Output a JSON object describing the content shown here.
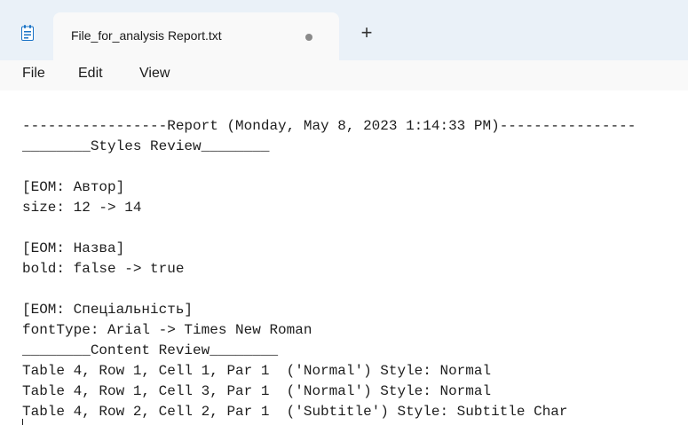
{
  "tab": {
    "title": "File_for_analysis Report.txt",
    "new_tab_label": "+"
  },
  "menu": {
    "file": "File",
    "edit": "Edit",
    "view": "View"
  },
  "icons": {
    "app": "notepad-icon",
    "unsaved": "unsaved-dot-icon",
    "new_tab": "plus-icon"
  },
  "colors": {
    "tabbar_bg": "#eaf1f8",
    "tab_bg": "#f9f9f9",
    "icon_accent": "#1a73c6"
  },
  "content": {
    "lines": [
      "-----------------Report (Monday, May 8, 2023 1:14:33 PM)----------------",
      "________Styles Review________",
      "",
      "[EOM: Автор]",
      "size: 12 -> 14",
      "",
      "[EOM: Назва]",
      "bold: false -> true",
      "",
      "[EOM: Спеціальність]",
      "fontType: Arial -> Times New Roman",
      "________Content Review________",
      "Table 4, Row 1, Cell 1, Par 1  ('Normal') Style: Normal",
      "Table 4, Row 1, Cell 3, Par 1  ('Normal') Style: Normal",
      "Table 4, Row 2, Cell 2, Par 1  ('Subtitle') Style: Subtitle Char"
    ]
  }
}
